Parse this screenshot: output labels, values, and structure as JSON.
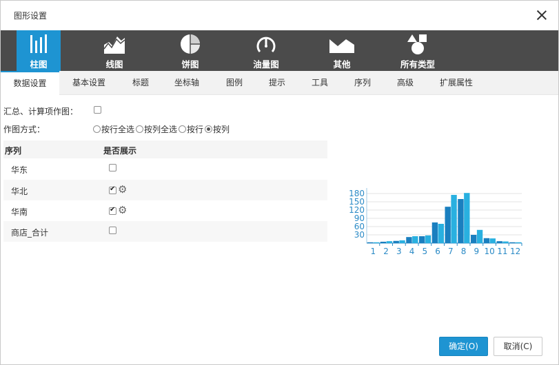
{
  "dialog": {
    "title": "图形设置"
  },
  "chart_types": [
    {
      "label": "柱图",
      "icon": "bar-chart-icon",
      "active": true
    },
    {
      "label": "线图",
      "icon": "line-chart-icon",
      "active": false
    },
    {
      "label": "饼图",
      "icon": "pie-chart-icon",
      "active": false
    },
    {
      "label": "油量图",
      "icon": "gauge-icon",
      "active": false
    },
    {
      "label": "其他",
      "icon": "other-chart-icon",
      "active": false
    },
    {
      "label": "所有类型",
      "icon": "all-types-icon",
      "active": false
    }
  ],
  "tabs": [
    "数据设置",
    "基本设置",
    "标题",
    "坐标轴",
    "图例",
    "提示",
    "工具",
    "序列",
    "高级",
    "扩展属性"
  ],
  "settings": {
    "summary_label": "汇总、计算项作图：",
    "plot_mode_label": "作图方式：",
    "plot_modes": [
      "按行全选",
      "按列全选",
      "按行",
      "按列"
    ],
    "selected_mode": 3
  },
  "series_table": {
    "headers": [
      "序列",
      "是否展示"
    ],
    "rows": [
      {
        "name": "华东",
        "shown": false
      },
      {
        "name": "华北",
        "shown": true
      },
      {
        "name": "华南",
        "shown": true
      },
      {
        "name": "商店_合计",
        "shown": false
      }
    ]
  },
  "buttons": {
    "ok": "确定(O)",
    "cancel": "取消(C)"
  },
  "colors": {
    "accent": "#1e94d2",
    "toolbar_bg": "#4b4b4b",
    "series_1": "#1a7fbf",
    "series_2": "#29b0e0"
  },
  "chart_data": {
    "type": "bar",
    "categories": [
      "1",
      "2",
      "3",
      "4",
      "5",
      "6",
      "7",
      "8",
      "9",
      "10",
      "11",
      "12"
    ],
    "series": [
      {
        "values": [
          3,
          5,
          8,
          22,
          25,
          75,
          132,
          160,
          30,
          18,
          7,
          3
        ]
      },
      {
        "values": [
          3,
          7,
          10,
          25,
          28,
          70,
          175,
          182,
          48,
          17,
          6,
          3
        ]
      }
    ],
    "y_ticks": [
      "30",
      "60",
      "90",
      "120",
      "150",
      "180"
    ],
    "ylim": [
      0,
      200
    ],
    "grid": true
  }
}
